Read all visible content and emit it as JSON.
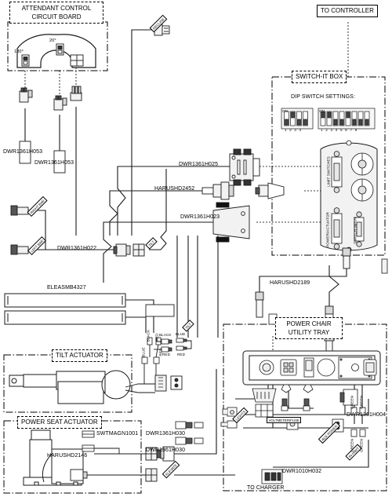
{
  "diagram": {
    "title_blocks": {
      "attendant_control": "ATTENDANT CONTROL\nCIRCUIT BOARD",
      "attendant_control_line1": "ATTENDANT CONTROL",
      "attendant_control_line2": "CIRCUIT BOARD",
      "to_controller": "TO CONTROLLER",
      "switch_it_box": "SWITCH-IT BOX",
      "tilt_actuator": "TILT ACTUATOR",
      "power_seat_actuator": "POWER SEAT ACTUATOR",
      "power_chair_tray_line1": "POWER CHAIR",
      "power_chair_tray_line2": "UTILITY TRAY"
    },
    "circuit_board": {
      "angle_180": "180°",
      "angle_20": "20°"
    },
    "switch_box": {
      "dip_heading": "DIP SWITCH SETTINGS:",
      "bank1_on": "ON",
      "bank1_numbers": [
        "1",
        "2",
        "3",
        "4"
      ],
      "bank2_on": "ON",
      "bank2_numbers": [
        "1",
        "2",
        "3",
        "4",
        "5",
        "6",
        "7",
        "8"
      ],
      "port_limit_switches": "LIMIT SWITCHES",
      "port_power_actuator": "POWER/ACTUATOR",
      "port_switch_input": "SWITCH INPUT"
    },
    "part_numbers": {
      "h053_left": "DWR1361H053",
      "h053_mid": "DWR1361H053",
      "h025": "DWR1361H025",
      "hd2452": "HARUSHD2452",
      "h023": "DWR1361H023",
      "h022": "DWR1361H022",
      "eleasmb": "ELEASMB4327",
      "hd2189": "HARUSHD2189",
      "h004": "DWR1361H004",
      "h030_top": "DWR1361H030",
      "h030_bottom": "DWR1361H030",
      "hd2146": "HARUSHD2146",
      "swtmagn": "SWTMAGN1001",
      "h032": "DWR1010H032"
    },
    "wire_tags": {
      "recline": "RECLINE",
      "right_bar": "RIGHT BAR",
      "left_bar": "LEFT BAR",
      "tilt_small": "TILT",
      "tilt_eleasm": "TILT",
      "elevate": "ELEVATE",
      "lights": "LIGHTS",
      "voltmeter_fuse": "VOLTMETER/FUSE",
      "aux_power": "AUX POWER",
      "inhibit": "IN-HIBIT"
    },
    "wire_colors": {
      "black_top": "BLACK",
      "blue_top": "BLUE",
      "red_a": "RED",
      "red_b": "RED",
      "black_v": "BLACK",
      "red_v": "RED",
      "blue_v": "BLUE",
      "red_v2": "RED",
      "green_1": "GREEN",
      "green_2": "GREEN",
      "green_3": "GREEN",
      "green_4": "GREEN"
    },
    "end_labels": {
      "to_charger": "TO CHARGER"
    },
    "colors": {
      "line": "#1a1a1a",
      "fill_light": "#f2f2f2",
      "fill_mid": "#d8d8d8",
      "fill_dark": "#555555",
      "paper": "#ffffff"
    }
  }
}
